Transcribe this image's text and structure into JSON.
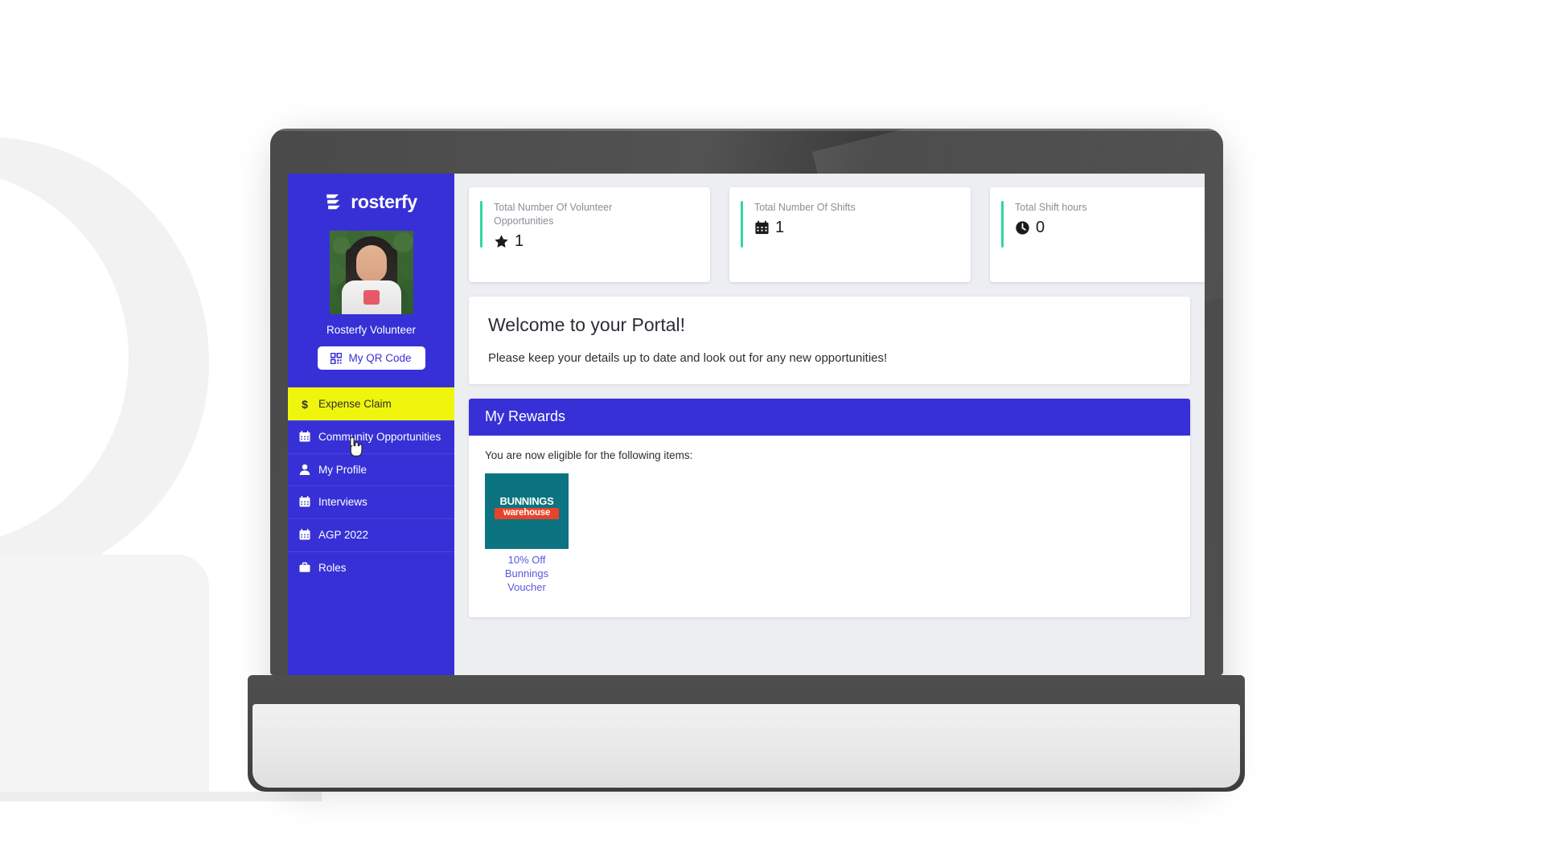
{
  "sidebar": {
    "brand_name": "rosterfy",
    "brand_logo_icon": "rosterfy-bars-logo",
    "user_name": "Rosterfy Volunteer",
    "qr_button_label": "My QR Code",
    "qr_button_icon": "qr-code-icon",
    "nav_items": [
      {
        "label": "Expense Claim",
        "icon": "dollar-icon",
        "active": true
      },
      {
        "label": "Community Opportunities",
        "icon": "calendar-icon",
        "active": false
      },
      {
        "label": "My Profile",
        "icon": "person-icon",
        "active": false
      },
      {
        "label": "Interviews",
        "icon": "calendar-icon",
        "active": false
      },
      {
        "label": "AGP 2022",
        "icon": "calendar-icon",
        "active": false
      },
      {
        "label": "Roles",
        "icon": "briefcase-icon",
        "active": false
      }
    ]
  },
  "stat_cards": [
    {
      "title": "Total Number Of Volunteer Opportunities",
      "value": "1",
      "icon": "star-icon",
      "accent_color": "#2fd89a"
    },
    {
      "title": "Total Number Of Shifts",
      "value": "1",
      "icon": "calendar-icon",
      "accent_color": "#2fd89a"
    },
    {
      "title": "Total Shift hours",
      "value": "0",
      "icon": "clock-icon",
      "accent_color": "#2fd89a"
    }
  ],
  "welcome": {
    "title": "Welcome to your Portal!",
    "subtitle": "Please keep your details up to date and look out for any new opportunities!"
  },
  "rewards": {
    "header": "My Rewards",
    "note": "You are now eligible for the following items:",
    "items": [
      {
        "caption": "10% Off Bunnings Voucher",
        "logo_top": "BUNNINGS",
        "logo_bottom": "warehouse",
        "thumb_color": "#0b7480"
      }
    ]
  },
  "theme": {
    "brand_blue": "#3730d6",
    "highlight_yellow": "#f0f50d",
    "accent_green": "#2fd89a",
    "link_purple": "#5a57e0"
  }
}
